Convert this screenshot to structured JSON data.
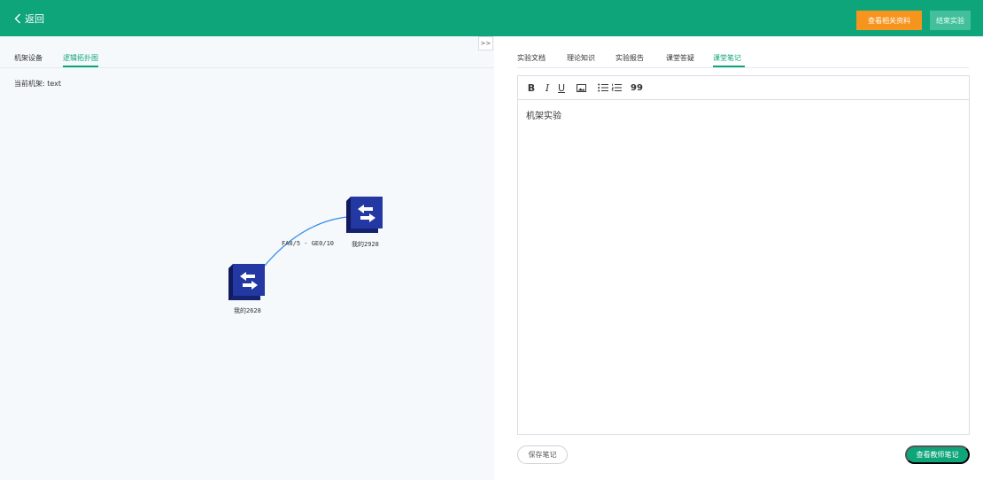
{
  "header": {
    "back_label": "返回",
    "view_materials_label": "查看相关资料",
    "end_experiment_label": "结束实验"
  },
  "left_panel": {
    "tabs": [
      {
        "label": "机架设备"
      },
      {
        "label": "逻辑拓扑图"
      }
    ],
    "current_rack_label": "当前机架: text",
    "collapse_label": ">>"
  },
  "topology": {
    "nodes": [
      {
        "label": "我的2928"
      },
      {
        "label": "我的2628"
      }
    ],
    "link_label": "FA0/5 - GE0/10"
  },
  "right_panel": {
    "tabs": [
      {
        "label": "实验文档"
      },
      {
        "label": "理论知识"
      },
      {
        "label": "实验报告"
      },
      {
        "label": "课堂答疑"
      },
      {
        "label": "课堂笔记"
      }
    ],
    "toolbar": {
      "bold": "B",
      "italic": "I",
      "underline": "U",
      "quote": "99"
    },
    "editor_content": "机架实验",
    "save_label": "保存笔记",
    "teacher_notes_label": "查看教师笔记"
  },
  "colors": {
    "brand": "#0fa57b",
    "orange": "#f7941d",
    "device": "#1b2a8a"
  }
}
